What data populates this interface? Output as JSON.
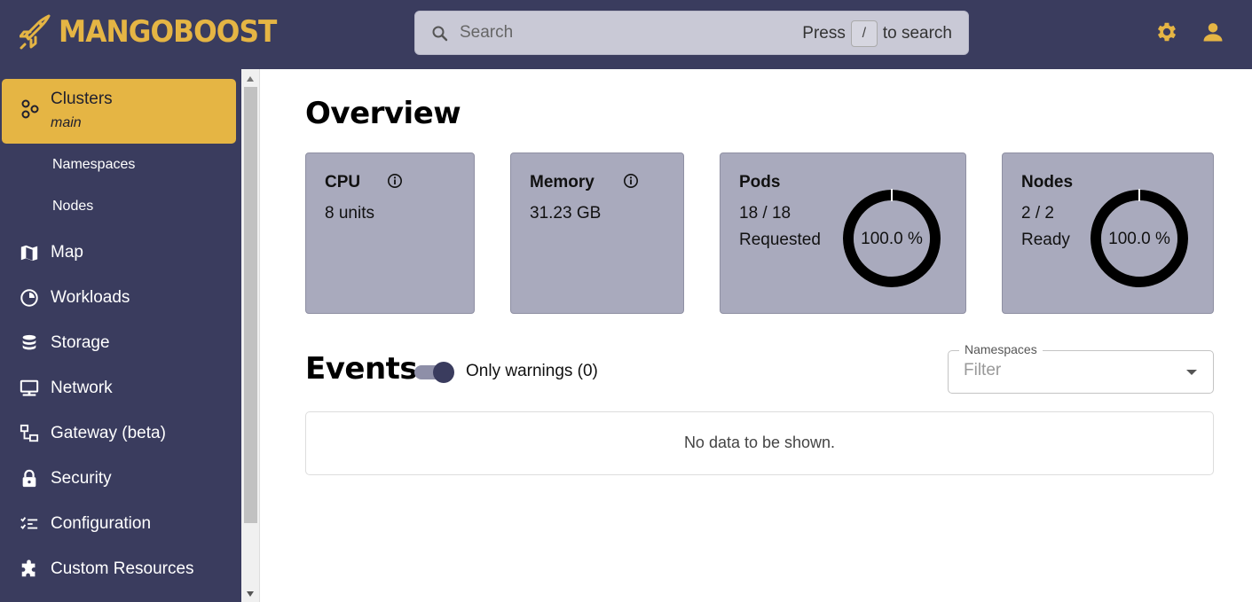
{
  "brand": {
    "name": "MANGOBOOST",
    "accent": "#e5b544",
    "nav_bg": "#3a3c5e"
  },
  "search": {
    "placeholder": "Search",
    "hint_prefix": "Press",
    "hint_key": "/",
    "hint_suffix": "to search"
  },
  "header_icons": [
    "settings-icon",
    "user-icon"
  ],
  "sidebar": {
    "active": {
      "label": "Clusters",
      "sublabel": "main",
      "icon": "clusters-icon"
    },
    "subitems": [
      "Namespaces",
      "Nodes"
    ],
    "items": [
      {
        "label": "Map",
        "icon": "map-icon"
      },
      {
        "label": "Workloads",
        "icon": "workloads-icon"
      },
      {
        "label": "Storage",
        "icon": "storage-icon"
      },
      {
        "label": "Network",
        "icon": "network-icon"
      },
      {
        "label": "Gateway (beta)",
        "icon": "gateway-icon"
      },
      {
        "label": "Security",
        "icon": "lock-icon"
      },
      {
        "label": "Configuration",
        "icon": "configuration-icon"
      },
      {
        "label": "Custom Resources",
        "icon": "puzzle-icon"
      }
    ]
  },
  "overview": {
    "title": "Overview",
    "cpu": {
      "title": "CPU",
      "value": "8 units"
    },
    "memory": {
      "title": "Memory",
      "value": "31.23 GB"
    },
    "pods": {
      "title": "Pods",
      "value": "18 / 18",
      "status": "Requested",
      "percent_label": "100.0 %",
      "fraction": 1.0
    },
    "nodes": {
      "title": "Nodes",
      "value": "2 / 2",
      "status": "Ready",
      "percent_label": "100.0 %",
      "fraction": 1.0
    }
  },
  "events": {
    "title": "Events",
    "toggle_label": "Only warnings (0)",
    "toggle_on": true,
    "namespaces_legend": "Namespaces",
    "namespaces_placeholder": "Filter",
    "empty_message": "No data to be shown."
  }
}
